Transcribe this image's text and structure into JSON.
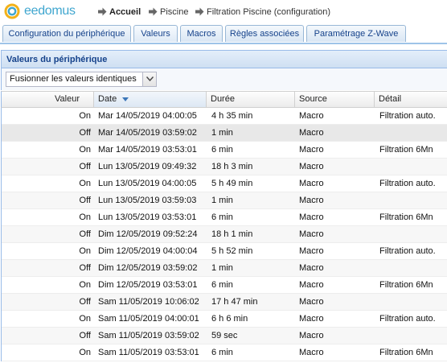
{
  "app": {
    "logo_text": "eedomus"
  },
  "breadcrumb": [
    "Accueil",
    "Piscine",
    "Filtration Piscine (configuration)"
  ],
  "tabs": [
    "Configuration du périphérique",
    "Valeurs",
    "Macros",
    "Règles associées",
    "Paramétrage Z-Wave"
  ],
  "panel": {
    "title": "Valeurs du périphérique",
    "merge_select_value": "Fusionner les valeurs identiques"
  },
  "columns": {
    "value": "Valeur",
    "date": "Date",
    "duration": "Durée",
    "source": "Source",
    "detail": "Détail"
  },
  "rows": [
    {
      "value": "On",
      "date": "Mar 14/05/2019 04:00:05",
      "duration": "4 h 35 min",
      "source": "Macro",
      "detail": "Filtration auto."
    },
    {
      "value": "Off",
      "date": "Mar 14/05/2019 03:59:02",
      "duration": "1 min",
      "source": "Macro",
      "detail": ""
    },
    {
      "value": "On",
      "date": "Mar 14/05/2019 03:53:01",
      "duration": "6 min",
      "source": "Macro",
      "detail": "Filtration 6Mn"
    },
    {
      "value": "Off",
      "date": "Lun 13/05/2019 09:49:32",
      "duration": "18 h 3 min",
      "source": "Macro",
      "detail": ""
    },
    {
      "value": "On",
      "date": "Lun 13/05/2019 04:00:05",
      "duration": "5 h 49 min",
      "source": "Macro",
      "detail": "Filtration auto."
    },
    {
      "value": "Off",
      "date": "Lun 13/05/2019 03:59:03",
      "duration": "1 min",
      "source": "Macro",
      "detail": ""
    },
    {
      "value": "On",
      "date": "Lun 13/05/2019 03:53:01",
      "duration": "6 min",
      "source": "Macro",
      "detail": "Filtration 6Mn"
    },
    {
      "value": "Off",
      "date": "Dim 12/05/2019 09:52:24",
      "duration": "18 h 1 min",
      "source": "Macro",
      "detail": ""
    },
    {
      "value": "On",
      "date": "Dim 12/05/2019 04:00:04",
      "duration": "5 h 52 min",
      "source": "Macro",
      "detail": "Filtration auto."
    },
    {
      "value": "Off",
      "date": "Dim 12/05/2019 03:59:02",
      "duration": "1 min",
      "source": "Macro",
      "detail": ""
    },
    {
      "value": "On",
      "date": "Dim 12/05/2019 03:53:01",
      "duration": "6 min",
      "source": "Macro",
      "detail": "Filtration 6Mn"
    },
    {
      "value": "Off",
      "date": "Sam 11/05/2019 10:06:02",
      "duration": "17 h 47 min",
      "source": "Macro",
      "detail": ""
    },
    {
      "value": "On",
      "date": "Sam 11/05/2019 04:00:01",
      "duration": "6 h 6 min",
      "source": "Macro",
      "detail": "Filtration auto."
    },
    {
      "value": "Off",
      "date": "Sam 11/05/2019 03:59:02",
      "duration": "59 sec",
      "source": "Macro",
      "detail": ""
    },
    {
      "value": "On",
      "date": "Sam 11/05/2019 03:53:01",
      "duration": "6 min",
      "source": "Macro",
      "detail": "Filtration 6Mn"
    }
  ]
}
